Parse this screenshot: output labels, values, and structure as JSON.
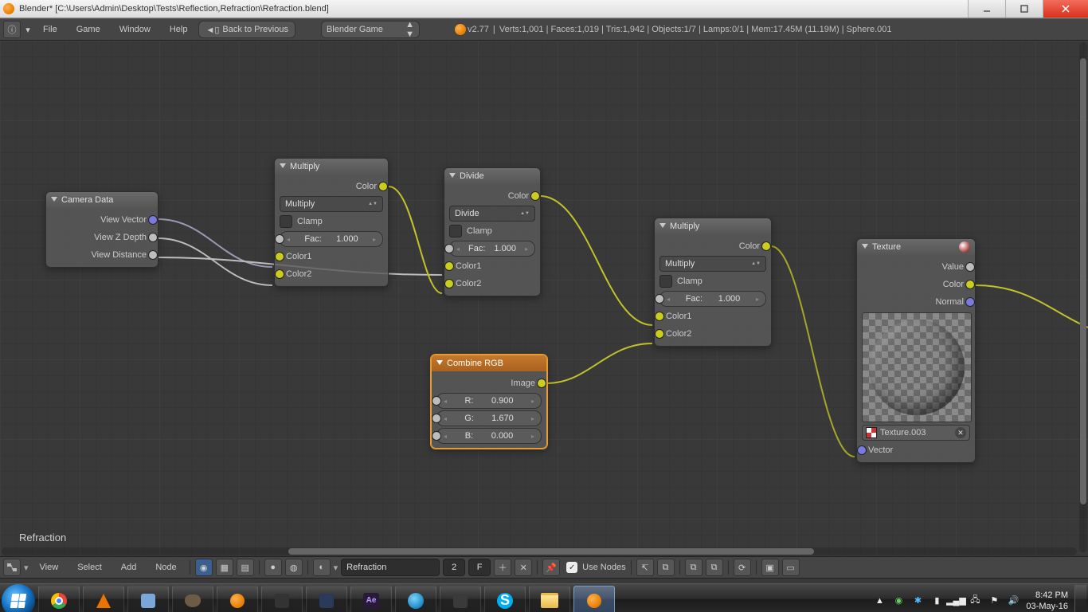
{
  "window": {
    "title": "Blender* [C:\\Users\\Admin\\Desktop\\Tests\\Reflection,Refraction\\Refraction.blend]"
  },
  "topbar": {
    "menus": {
      "file": "File",
      "game": "Game",
      "window": "Window",
      "help": "Help"
    },
    "back_button": "Back to Previous",
    "engine": "Blender Game",
    "version": "v2.77",
    "stats": "Verts:1,001 | Faces:1,019 | Tris:1,942 | Objects:1/7 | Lamps:0/1 | Mem:17.45M (11.19M) | Sphere.001"
  },
  "canvas": {
    "material_name": "Refraction"
  },
  "nodes": {
    "camera": {
      "title": "Camera Data",
      "outs": {
        "view_vector": "View Vector",
        "view_z": "View Z Depth",
        "view_dist": "View Distance"
      }
    },
    "mul1": {
      "title": "Multiply",
      "op_label": "Multiply",
      "clamp": "Clamp",
      "fac_label": "Fac:",
      "fac_value": "1.000",
      "out_color": "Color",
      "in_color1": "Color1",
      "in_color2": "Color2"
    },
    "divide": {
      "title": "Divide",
      "op_label": "Divide",
      "clamp": "Clamp",
      "fac_label": "Fac:",
      "fac_value": "1.000",
      "out_color": "Color",
      "in_color1": "Color1",
      "in_color2": "Color2"
    },
    "mul2": {
      "title": "Multiply",
      "op_label": "Multiply",
      "clamp": "Clamp",
      "fac_label": "Fac:",
      "fac_value": "1.000",
      "out_color": "Color",
      "in_color1": "Color1",
      "in_color2": "Color2"
    },
    "combine": {
      "title": "Combine RGB",
      "out_image": "Image",
      "r_label": "R:",
      "r_value": "0.900",
      "g_label": "G:",
      "g_value": "1.670",
      "b_label": "B:",
      "b_value": "0.000"
    },
    "texture": {
      "title": "Texture",
      "out_value": "Value",
      "out_color": "Color",
      "out_normal": "Normal",
      "tex_name": "Texture.003",
      "in_vector": "Vector"
    }
  },
  "nodehdr": {
    "menus": {
      "view": "View",
      "select": "Select",
      "add": "Add",
      "node": "Node"
    },
    "material_name": "Refraction",
    "users": "2",
    "fake": "F",
    "use_nodes": "Use Nodes"
  },
  "tray": {
    "time": "8:42 PM",
    "date": "03-May-16"
  }
}
